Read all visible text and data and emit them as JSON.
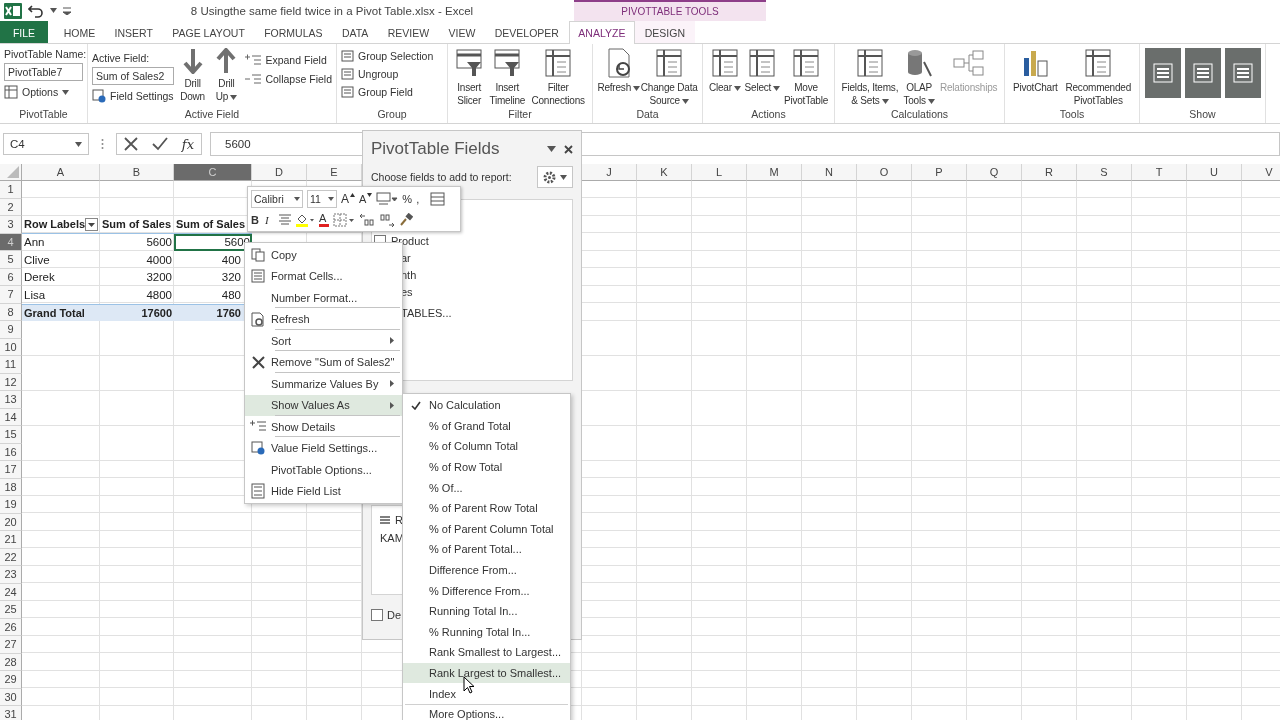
{
  "title_bar": {
    "title": "8 Usingthe same field twice in a Pivot Table.xlsx - Excel",
    "context_label": "PIVOTTABLE TOOLS"
  },
  "tabs": [
    {
      "label": "FILE",
      "kind": "file",
      "selected": false
    },
    {
      "label": "HOME",
      "kind": "tab",
      "selected": false
    },
    {
      "label": "INSERT",
      "kind": "tab",
      "selected": false
    },
    {
      "label": "PAGE LAYOUT",
      "kind": "tab",
      "selected": false
    },
    {
      "label": "FORMULAS",
      "kind": "tab",
      "selected": false
    },
    {
      "label": "DATA",
      "kind": "tab",
      "selected": false
    },
    {
      "label": "REVIEW",
      "kind": "tab",
      "selected": false
    },
    {
      "label": "VIEW",
      "kind": "tab",
      "selected": false
    },
    {
      "label": "DEVELOPER",
      "kind": "tab",
      "selected": false
    },
    {
      "label": "ANALYZE",
      "kind": "context",
      "selected": true
    },
    {
      "label": "DESIGN",
      "kind": "context",
      "selected": false
    }
  ],
  "ribbon": {
    "pivottable": {
      "name_label": "PivotTable Name:",
      "name_value": "PivotTable7",
      "options": "Options",
      "caption": "PivotTable"
    },
    "active_field": {
      "label": "Active Field:",
      "value": "Sum of Sales2",
      "settings": "Field Settings",
      "caption": "Active Field",
      "expand": "Expand Field",
      "collapse": "Collapse Field",
      "drill": [
        {
          "label": "Drill\nDown",
          "kind": "down",
          "dropdown": false
        },
        {
          "label": "Drill\nUp",
          "kind": "up",
          "dropdown": true
        }
      ]
    },
    "group": {
      "caption": "Group",
      "items": [
        "Group Selection",
        "Ungroup",
        "Group Field"
      ]
    },
    "big_groups": [
      {
        "caption": "Filter",
        "buttons": [
          {
            "label": "Insert\nSlicer",
            "kind": "slicer",
            "dropdown": false,
            "disabled": false
          },
          {
            "label": "Insert\nTimeline",
            "kind": "timeline",
            "dropdown": false,
            "disabled": false
          },
          {
            "label": "Filter\nConnections",
            "kind": "table",
            "dropdown": false,
            "disabled": false
          }
        ]
      },
      {
        "caption": "Data",
        "buttons": [
          {
            "label": "Refresh",
            "kind": "refresh",
            "dropdown": true,
            "disabled": false
          },
          {
            "label": "Change Data\nSource",
            "kind": "table",
            "dropdown": true,
            "disabled": false
          }
        ]
      },
      {
        "caption": "Actions",
        "buttons": [
          {
            "label": "Clear",
            "kind": "table",
            "dropdown": true,
            "disabled": false
          },
          {
            "label": "Select",
            "kind": "table",
            "dropdown": true,
            "disabled": false
          },
          {
            "label": "Move\nPivotTable",
            "kind": "table",
            "dropdown": false,
            "disabled": false
          }
        ]
      },
      {
        "caption": "Calculations",
        "buttons": [
          {
            "label": "Fields, Items,\n& Sets",
            "kind": "table",
            "dropdown": true,
            "disabled": false
          },
          {
            "label": "OLAP\nTools",
            "kind": "cylinder",
            "dropdown": true,
            "disabled": false
          },
          {
            "label": "Relationships",
            "kind": "relations",
            "dropdown": false,
            "disabled": true
          }
        ]
      },
      {
        "caption": "Tools",
        "buttons": [
          {
            "label": "PivotChart",
            "kind": "chart",
            "dropdown": false,
            "disabled": false
          },
          {
            "label": "Recommended\nPivotTables",
            "kind": "table",
            "dropdown": false,
            "disabled": false
          }
        ]
      }
    ],
    "show": {
      "caption": "Show",
      "toggles": [
        {
          "on": true
        },
        {
          "on": true
        },
        {
          "on": true
        }
      ]
    }
  },
  "formula_bar": {
    "name_box": "C4",
    "fx": "fx",
    "value": "5600"
  },
  "sheet": {
    "columns_left": [
      {
        "label": "A",
        "selected": false
      },
      {
        "label": "B",
        "selected": false
      },
      {
        "label": "C",
        "selected": true
      },
      {
        "label": "D",
        "selected": false
      },
      {
        "label": "E",
        "selected": false
      }
    ],
    "columns_right": [
      {
        "label": "J",
        "selected": false
      },
      {
        "label": "K",
        "selected": false
      },
      {
        "label": "L",
        "selected": false
      },
      {
        "label": "M",
        "selected": false
      },
      {
        "label": "N",
        "selected": false
      },
      {
        "label": "O",
        "selected": false
      },
      {
        "label": "P",
        "selected": false
      },
      {
        "label": "Q",
        "selected": false
      },
      {
        "label": "R",
        "selected": false
      },
      {
        "label": "S",
        "selected": false
      },
      {
        "label": "T",
        "selected": false
      },
      {
        "label": "U",
        "selected": false
      },
      {
        "label": "V",
        "selected": false
      }
    ],
    "rows": [
      {
        "label": "1",
        "selected": false
      },
      {
        "label": "2",
        "selected": false
      },
      {
        "label": "3",
        "selected": false,
        "kind": "header",
        "cells": [
          {
            "text": "Row Labels",
            "selected": false
          },
          {
            "text": "Sum of Sales",
            "selected": false
          },
          {
            "text": "Sum of Sales",
            "selected": false
          }
        ]
      },
      {
        "label": "4",
        "selected": true,
        "kind": "item",
        "cells": [
          {
            "text": "Ann",
            "selected": false
          },
          {
            "text": "5600",
            "selected": false
          },
          {
            "text": "5600",
            "selected": true
          }
        ]
      },
      {
        "label": "5",
        "selected": false,
        "kind": "item",
        "cells": [
          {
            "text": "Clive",
            "selected": false
          },
          {
            "text": "4000",
            "selected": false
          },
          {
            "text": "400",
            "selected": false
          }
        ]
      },
      {
        "label": "6",
        "selected": false,
        "kind": "item",
        "cells": [
          {
            "text": "Derek",
            "selected": false
          },
          {
            "text": "3200",
            "selected": false
          },
          {
            "text": "320",
            "selected": false
          }
        ]
      },
      {
        "label": "7",
        "selected": false,
        "kind": "item",
        "cells": [
          {
            "text": "Lisa",
            "selected": false
          },
          {
            "text": "4800",
            "selected": false
          },
          {
            "text": "480",
            "selected": false
          }
        ]
      },
      {
        "label": "8",
        "selected": false,
        "kind": "total",
        "cells": [
          {
            "text": "Grand Total",
            "selected": false
          },
          {
            "text": "17600",
            "selected": false
          },
          {
            "text": "1760",
            "selected": false
          }
        ]
      },
      {
        "label": "9",
        "selected": false
      },
      {
        "label": "10",
        "selected": false
      },
      {
        "label": "11",
        "selected": false
      },
      {
        "label": "12",
        "selected": false
      },
      {
        "label": "13",
        "selected": false
      },
      {
        "label": "14",
        "selected": false
      },
      {
        "label": "15",
        "selected": false
      },
      {
        "label": "16",
        "selected": false
      },
      {
        "label": "17",
        "selected": false
      },
      {
        "label": "18",
        "selected": false
      },
      {
        "label": "19",
        "selected": false
      },
      {
        "label": "20",
        "selected": false
      },
      {
        "label": "21",
        "selected": false
      },
      {
        "label": "22",
        "selected": false
      },
      {
        "label": "23",
        "selected": false
      },
      {
        "label": "24",
        "selected": false
      },
      {
        "label": "25",
        "selected": false
      },
      {
        "label": "26",
        "selected": false
      },
      {
        "label": "27",
        "selected": false
      },
      {
        "label": "28",
        "selected": false
      },
      {
        "label": "29",
        "selected": false
      },
      {
        "label": "30",
        "selected": false
      },
      {
        "label": "31",
        "selected": false
      }
    ]
  },
  "field_pane": {
    "title": "PivotTable Fields",
    "choose_label": "Choose fields to add to report:",
    "fields": [
      {
        "label": "Product",
        "checked": false
      }
    ],
    "field_fragments": [
      "ar",
      "nth",
      "es"
    ],
    "more_tables": "TABLES...",
    "rows_area": {
      "label": "R",
      "item": "KAM"
    },
    "defer": {
      "label": "De",
      "checked": false
    }
  },
  "mini_toolbar": {
    "font": "Calibri",
    "size": "11",
    "grow": "A",
    "shrink": "A",
    "percent": "%",
    "comma": ",",
    "bold": "B",
    "italic": "I",
    "font_color": "A"
  },
  "context_menu": [
    {
      "label": "Copy",
      "kind": "copy",
      "submenu": false,
      "selected": false,
      "separator_after": false
    },
    {
      "label": "Format Cells...",
      "kind": "format",
      "submenu": false,
      "selected": false,
      "separator_after": false
    },
    {
      "label": "Number Format...",
      "kind": "plain",
      "submenu": false,
      "selected": false,
      "separator_after": true
    },
    {
      "label": "Refresh",
      "kind": "refresh",
      "submenu": false,
      "selected": false,
      "separator_after": true
    },
    {
      "label": "Sort",
      "kind": "plain",
      "submenu": true,
      "selected": false,
      "separator_after": true
    },
    {
      "label": "Remove \"Sum of Sales2\"",
      "kind": "remove",
      "submenu": false,
      "selected": false,
      "separator_after": true
    },
    {
      "label": "Summarize Values By",
      "kind": "plain",
      "submenu": true,
      "selected": false,
      "separator_after": false
    },
    {
      "label": "Show Values As",
      "kind": "plain",
      "submenu": true,
      "selected": true,
      "separator_after": true
    },
    {
      "label": "Show Details",
      "kind": "details",
      "submenu": false,
      "selected": false,
      "separator_after": true
    },
    {
      "label": "Value Field Settings...",
      "kind": "settings",
      "submenu": false,
      "selected": false,
      "separator_after": false
    },
    {
      "label": "PivotTable Options...",
      "kind": "plain",
      "submenu": false,
      "selected": false,
      "separator_after": false
    },
    {
      "label": "Hide Field List",
      "kind": "fieldlist",
      "submenu": false,
      "selected": false,
      "separator_after": false
    }
  ],
  "submenu": [
    {
      "label": "No Calculation",
      "checked": true,
      "selected": false,
      "separator_before": false
    },
    {
      "label": "% of Grand Total",
      "checked": false,
      "selected": false,
      "separator_before": false
    },
    {
      "label": "% of Column Total",
      "checked": false,
      "selected": false,
      "separator_before": false
    },
    {
      "label": "% of Row Total",
      "checked": false,
      "selected": false,
      "separator_before": false
    },
    {
      "label": "% Of...",
      "checked": false,
      "selected": false,
      "separator_before": false
    },
    {
      "label": "% of Parent Row Total",
      "checked": false,
      "selected": false,
      "separator_before": false
    },
    {
      "label": "% of Parent Column Total",
      "checked": false,
      "selected": false,
      "separator_before": false
    },
    {
      "label": "% of Parent Total...",
      "checked": false,
      "selected": false,
      "separator_before": false
    },
    {
      "label": "Difference From...",
      "checked": false,
      "selected": false,
      "separator_before": false
    },
    {
      "label": "% Difference From...",
      "checked": false,
      "selected": false,
      "separator_before": false
    },
    {
      "label": "Running Total In...",
      "checked": false,
      "selected": false,
      "separator_before": false
    },
    {
      "label": "% Running Total In...",
      "checked": false,
      "selected": false,
      "separator_before": false
    },
    {
      "label": "Rank Smallest to Largest...",
      "checked": false,
      "selected": false,
      "separator_before": false
    },
    {
      "label": "Rank Largest to Smallest...",
      "checked": false,
      "selected": true,
      "separator_before": false
    },
    {
      "label": "Index",
      "checked": false,
      "selected": false,
      "separator_before": false
    },
    {
      "label": "More Options...",
      "checked": false,
      "selected": false,
      "separator_before": true
    }
  ]
}
